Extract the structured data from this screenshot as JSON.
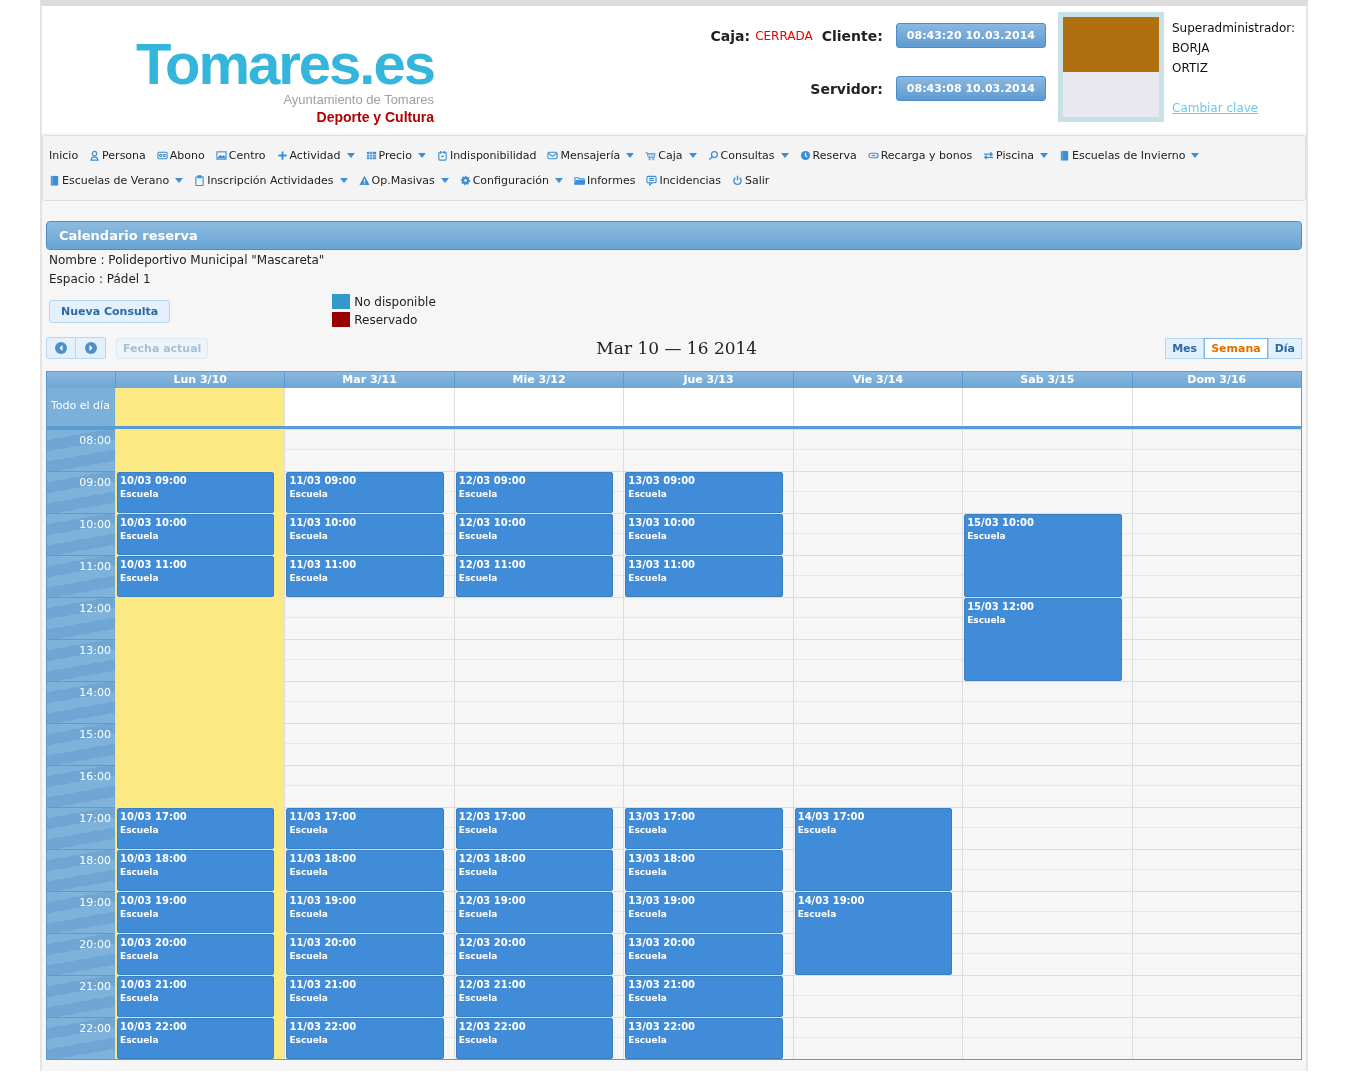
{
  "header": {
    "logo": {
      "name": "Tomares.es",
      "subtitle": "Ayuntamiento de Tomares",
      "section": "Deporte y Cultura"
    },
    "caja": {
      "label": "Caja:",
      "status": "CERRADA"
    },
    "clocks": [
      {
        "label": "Cliente:",
        "value": "08:43:20 10.03.2014"
      },
      {
        "label": "Servidor:",
        "value": "08:43:08 10.03.2014"
      }
    ],
    "user": {
      "role": "Superadministrador:",
      "lines": [
        "BORJA",
        "ORTIZ"
      ],
      "link": "Cambiar clave"
    }
  },
  "menu": {
    "items": [
      {
        "label": "Inicio",
        "dropdown": false
      },
      {
        "label": "Persona",
        "dropdown": false
      },
      {
        "label": "Abono",
        "dropdown": false
      },
      {
        "label": "Centro",
        "dropdown": false
      },
      {
        "label": "Actividad",
        "dropdown": true
      },
      {
        "label": "Precio",
        "dropdown": true
      },
      {
        "label": "Indisponibilidad",
        "dropdown": false
      },
      {
        "label": "Mensajería",
        "dropdown": true
      },
      {
        "label": "Caja",
        "dropdown": true
      },
      {
        "label": "Consultas",
        "dropdown": true
      },
      {
        "label": "Reserva",
        "dropdown": false
      },
      {
        "label": "Recarga y bonos",
        "dropdown": false
      },
      {
        "label": "Piscina",
        "dropdown": true
      },
      {
        "label": "Escuelas de Invierno",
        "dropdown": true
      },
      {
        "label": "Escuelas de Verano",
        "dropdown": true
      },
      {
        "label": "Inscripción Actividades",
        "dropdown": true
      },
      {
        "label": "Op.Masivas",
        "dropdown": true
      },
      {
        "label": "Configuración",
        "dropdown": true
      },
      {
        "label": "Informes",
        "dropdown": false
      },
      {
        "label": "Incidencias",
        "dropdown": false
      },
      {
        "label": "Salir",
        "dropdown": false
      }
    ]
  },
  "panel": {
    "title": "Calendario reserva",
    "info": [
      "Nombre : Polideportivo Municipal \"Mascareta\"",
      "Espacio : Pádel 1"
    ],
    "new_query": "Nueva Consulta",
    "legend": [
      {
        "label": "No disponible",
        "color": "#3399cc"
      },
      {
        "label": "Reservado",
        "color": "#990000"
      }
    ]
  },
  "calendar": {
    "today_button": {
      "label": "Fecha actual",
      "disabled": true
    },
    "range": "Mar 10 — 16 2014",
    "views": [
      {
        "label": "Mes",
        "selected": false
      },
      {
        "label": "Semana",
        "selected": true
      },
      {
        "label": "Día",
        "selected": false
      }
    ],
    "all_day": "Todo el día",
    "hours": [
      "08:00",
      "09:00",
      "10:00",
      "11:00",
      "12:00",
      "13:00",
      "14:00",
      "15:00",
      "16:00",
      "17:00",
      "18:00",
      "19:00",
      "20:00",
      "21:00",
      "22:00"
    ],
    "days": [
      {
        "label": "Lun 3/10",
        "today": true,
        "slots": [
          {
            "kind": "free"
          },
          {
            "kind": "event",
            "time": "10/03 09:00",
            "title": "Escuela"
          },
          {
            "kind": "event",
            "time": "10/03 10:00",
            "title": "Escuela"
          },
          {
            "kind": "event",
            "time": "10/03 11:00",
            "title": "Escuela"
          },
          {
            "kind": "free"
          },
          {
            "kind": "free"
          },
          {
            "kind": "free"
          },
          {
            "kind": "free"
          },
          {
            "kind": "free"
          },
          {
            "kind": "event",
            "time": "10/03 17:00",
            "title": "Escuela"
          },
          {
            "kind": "event",
            "time": "10/03 18:00",
            "title": "Escuela"
          },
          {
            "kind": "event",
            "time": "10/03 19:00",
            "title": "Escuela"
          },
          {
            "kind": "event",
            "time": "10/03 20:00",
            "title": "Escuela"
          },
          {
            "kind": "event",
            "time": "10/03 21:00",
            "title": "Escuela"
          },
          {
            "kind": "event",
            "time": "10/03 22:00",
            "title": "Escuela"
          }
        ]
      },
      {
        "label": "Mar 3/11",
        "today": false,
        "slots": [
          {
            "kind": "free"
          },
          {
            "kind": "event",
            "time": "11/03 09:00",
            "title": "Escuela"
          },
          {
            "kind": "event",
            "time": "11/03 10:00",
            "title": "Escuela"
          },
          {
            "kind": "event",
            "time": "11/03 11:00",
            "title": "Escuela"
          },
          {
            "kind": "free"
          },
          {
            "kind": "free"
          },
          {
            "kind": "free"
          },
          {
            "kind": "free"
          },
          {
            "kind": "free"
          },
          {
            "kind": "event",
            "time": "11/03 17:00",
            "title": "Escuela"
          },
          {
            "kind": "event",
            "time": "11/03 18:00",
            "title": "Escuela"
          },
          {
            "kind": "event",
            "time": "11/03 19:00",
            "title": "Escuela"
          },
          {
            "kind": "event",
            "time": "11/03 20:00",
            "title": "Escuela"
          },
          {
            "kind": "event",
            "time": "11/03 21:00",
            "title": "Escuela"
          },
          {
            "kind": "event",
            "time": "11/03 22:00",
            "title": "Escuela"
          }
        ]
      },
      {
        "label": "Mie 3/12",
        "today": false,
        "slots": [
          {
            "kind": "free"
          },
          {
            "kind": "event",
            "time": "12/03 09:00",
            "title": "Escuela"
          },
          {
            "kind": "event",
            "time": "12/03 10:00",
            "title": "Escuela"
          },
          {
            "kind": "event",
            "time": "12/03 11:00",
            "title": "Escuela"
          },
          {
            "kind": "free"
          },
          {
            "kind": "free"
          },
          {
            "kind": "free"
          },
          {
            "kind": "free"
          },
          {
            "kind": "free"
          },
          {
            "kind": "event",
            "time": "12/03 17:00",
            "title": "Escuela"
          },
          {
            "kind": "event",
            "time": "12/03 18:00",
            "title": "Escuela"
          },
          {
            "kind": "event",
            "time": "12/03 19:00",
            "title": "Escuela"
          },
          {
            "kind": "event",
            "time": "12/03 20:00",
            "title": "Escuela"
          },
          {
            "kind": "event",
            "time": "12/03 21:00",
            "title": "Escuela"
          },
          {
            "kind": "event",
            "time": "12/03 22:00",
            "title": "Escuela"
          }
        ]
      },
      {
        "label": "Jue 3/13",
        "today": false,
        "slots": [
          {
            "kind": "free"
          },
          {
            "kind": "event",
            "time": "13/03 09:00",
            "title": "Escuela"
          },
          {
            "kind": "event",
            "time": "13/03 10:00",
            "title": "Escuela"
          },
          {
            "kind": "event",
            "time": "13/03 11:00",
            "title": "Escuela"
          },
          {
            "kind": "free"
          },
          {
            "kind": "free"
          },
          {
            "kind": "free"
          },
          {
            "kind": "free"
          },
          {
            "kind": "free"
          },
          {
            "kind": "event",
            "time": "13/03 17:00",
            "title": "Escuela"
          },
          {
            "kind": "event",
            "time": "13/03 18:00",
            "title": "Escuela"
          },
          {
            "kind": "event",
            "time": "13/03 19:00",
            "title": "Escuela"
          },
          {
            "kind": "event",
            "time": "13/03 20:00",
            "title": "Escuela"
          },
          {
            "kind": "event",
            "time": "13/03 21:00",
            "title": "Escuela"
          },
          {
            "kind": "event",
            "time": "13/03 22:00",
            "title": "Escuela"
          }
        ]
      },
      {
        "label": "Vie 3/14",
        "today": false,
        "slots": [
          {
            "kind": "free"
          },
          {
            "kind": "free"
          },
          {
            "kind": "free"
          },
          {
            "kind": "free"
          },
          {
            "kind": "free"
          },
          {
            "kind": "free"
          },
          {
            "kind": "free"
          },
          {
            "kind": "free"
          },
          {
            "kind": "free"
          },
          {
            "kind": "event",
            "time": "14/03 17:00",
            "title": "Escuela"
          },
          {
            "kind": "cont"
          },
          {
            "kind": "event",
            "time": "14/03 19:00",
            "title": "Escuela"
          },
          {
            "kind": "cont"
          },
          {
            "kind": "free"
          },
          {
            "kind": "free"
          }
        ]
      },
      {
        "label": "Sab 3/15",
        "today": false,
        "slots": [
          {
            "kind": "free"
          },
          {
            "kind": "free"
          },
          {
            "kind": "event",
            "time": "15/03 10:00",
            "title": "Escuela"
          },
          {
            "kind": "cont"
          },
          {
            "kind": "event",
            "time": "15/03 12:00",
            "title": "Escuela"
          },
          {
            "kind": "cont"
          },
          {
            "kind": "free"
          },
          {
            "kind": "free"
          },
          {
            "kind": "free"
          },
          {
            "kind": "free"
          },
          {
            "kind": "free"
          },
          {
            "kind": "free"
          },
          {
            "kind": "free"
          },
          {
            "kind": "free"
          },
          {
            "kind": "free"
          }
        ]
      },
      {
        "label": "Dom 3/16",
        "today": false,
        "slots": [
          {
            "kind": "free"
          },
          {
            "kind": "free"
          },
          {
            "kind": "free"
          },
          {
            "kind": "free"
          },
          {
            "kind": "free"
          },
          {
            "kind": "free"
          },
          {
            "kind": "free"
          },
          {
            "kind": "free"
          },
          {
            "kind": "free"
          },
          {
            "kind": "free"
          },
          {
            "kind": "free"
          },
          {
            "kind": "free"
          },
          {
            "kind": "free"
          },
          {
            "kind": "free"
          },
          {
            "kind": "free"
          }
        ]
      }
    ]
  }
}
